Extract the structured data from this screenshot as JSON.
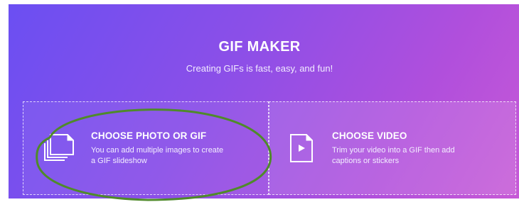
{
  "hero": {
    "title": "GIF MAKER",
    "subtitle": "Creating GIFs is fast, easy, and fun!"
  },
  "options": {
    "photo": {
      "icon": "image-stack-icon",
      "heading": "CHOOSE PHOTO OR GIF",
      "description_line1": "You can add multiple images to create",
      "description_line2": "a GIF slideshow"
    },
    "video": {
      "icon": "video-file-icon",
      "heading": "CHOOSE VIDEO",
      "description_line1": "Trim your video into a GIF then add",
      "description_line2": "captions or stickers"
    }
  },
  "colors": {
    "gradient_start": "#6b4ff2",
    "gradient_end": "#c85ad6",
    "annotation_ellipse": "#4f8a2a"
  }
}
